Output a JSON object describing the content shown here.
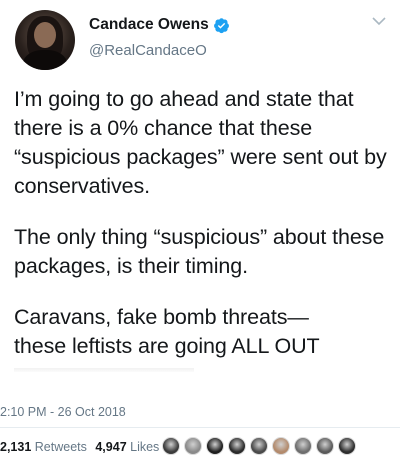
{
  "tweet": {
    "display_name": "Candace Owens",
    "handle": "@RealCandaceO",
    "paragraphs": [
      "I’m going to go ahead and state that there is a 0% chance that these “suspicious packages” were sent out by conservatives.",
      "The only thing “suspicious” about these packages, is their timing.",
      "Caravans, fake bomb threats—\nthese leftists are going ALL OUT"
    ],
    "timestamp": "2:10 PM - 26 Oct 2018",
    "retweets_count": "2,131",
    "retweets_label": "Retweets",
    "likes_count": "4,947",
    "likes_label": "Likes"
  },
  "icons": {
    "verified": "verified-badge-icon",
    "menu": "chevron-down-icon"
  },
  "colors": {
    "verified_blue": "#1da1f2",
    "secondary_text": "#657786",
    "primary_text": "#14171a"
  },
  "liker_avatars": [
    {
      "color": "#3b3b3b"
    },
    {
      "color": "#8a8a8a"
    },
    {
      "color": "#1f1f1f"
    },
    {
      "color": "#2b2b2b"
    },
    {
      "color": "#4a4a4a"
    },
    {
      "color": "#b38b6d"
    },
    {
      "color": "#6e6e6e"
    },
    {
      "color": "#5a5a5a"
    },
    {
      "color": "#2e2e2e"
    }
  ]
}
